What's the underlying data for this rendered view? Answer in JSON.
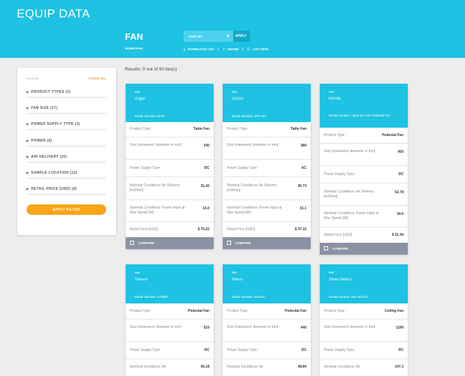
{
  "header": {
    "logo": "EQUIP DATA",
    "category_title": "FAN",
    "breadcrumb": "HOME>FAN",
    "sort_label": "SORT BY",
    "sort_icon": "sort-icon",
    "apply_label": "APPLY",
    "download_label": "DOWNLOAD CSV",
    "share_label": "SHARE",
    "listview_label": "LIST VIEW",
    "colors": {
      "accent": "#1ec2e2",
      "orange": "#f7a419"
    }
  },
  "sidebar": {
    "filter_by": "FILTER BY",
    "clear_all": "CLEAR ALL",
    "filters": [
      "PRODUCT TYPES (3)",
      "FAN SIZE (17)",
      "POWER SUPPLY TYPE (3)",
      "POWER (8)",
      "AIR DELIVERY (25)",
      "SAMPLE LOCATION (12)",
      "RETAIL PRICE [USD] (8)"
    ],
    "apply_filter": "APPLY FILTER"
  },
  "results_text": "Results: 9 out of 90 fan(s)",
  "labels": {
    "fan": "FAN",
    "product_type": "Product Type :",
    "size": "Size [measured, diameter in mm] :",
    "power_supply": "Power Supply Type :",
    "air_delivery": "Nominal Conditions: Air Delivery [m3/min] :",
    "power_input": "Nominal Conditions: Power Input at Max Speed [W] :",
    "retail_price": "Retail Price [USD] :",
    "compare": "COMPARE",
    "air_delivery_short": "Nominal Conditions: Air"
  },
  "cards": [
    {
      "brand": "d.light",
      "model": "Model Number: SF20",
      "product_type": "Table Fan",
      "size": "340",
      "power_supply": "DC",
      "air_delivery": "31.42",
      "power_input": "14.0",
      "price": "$ 75.02"
    },
    {
      "brand": "SOGO",
      "model": "Model Number: JPN-361",
      "product_type": "Table Fan",
      "size": "380",
      "power_supply": "AC",
      "air_delivery": "45.73",
      "power_input": "15.1",
      "price": "$ 37.15"
    },
    {
      "brand": "ROYAL",
      "model": "Model Number: Alpha DC 12V Pedestal Fan",
      "product_type": "Pedestal Fan",
      "size": "450",
      "power_supply": "DC",
      "air_delivery": "52.78",
      "power_input": "34.6",
      "price": "$ 21.44"
    },
    {
      "brand": "Tamoor",
      "model": "Model Number: 120950",
      "product_type": "Pedestal Fan",
      "size": "510",
      "power_supply": "DC",
      "air_delivery": "56.18"
    },
    {
      "brand": "Starco",
      "model": "Model Number: 204418",
      "product_type": "Pedestal Fan",
      "size": "440",
      "power_supply": "DC",
      "air_delivery": "48.84"
    },
    {
      "brand": "Silver Gallery",
      "model": "Model Number: ME-103-DC",
      "product_type": "Ceiling Fan",
      "size": "1190",
      "power_supply": "DC",
      "air_delivery": "147.3"
    }
  ]
}
